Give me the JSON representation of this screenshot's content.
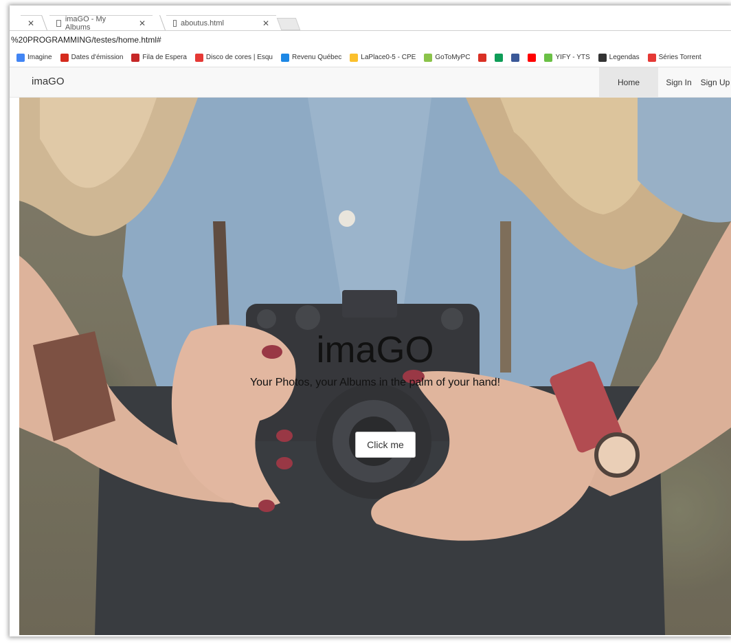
{
  "browser": {
    "tabs": [
      {
        "label": "imaGO - My Albums"
      },
      {
        "label": "aboutus.html"
      }
    ],
    "address": "%20PROGRAMMING/testes/home.html#",
    "bookmarks": [
      {
        "label": "Imagine",
        "icon": "apps-grid-icon",
        "color": "#4285f4"
      },
      {
        "label": "Dates d'émission",
        "icon": "maple-leaf-icon",
        "color": "#d52b1e"
      },
      {
        "label": "Fila de Espera",
        "icon": "bookmark-flag-icon",
        "color": "#c62828"
      },
      {
        "label": "Disco de cores | Esqu",
        "icon": "color-wheel-icon",
        "color": "#e53935"
      },
      {
        "label": "Revenu Québec",
        "icon": "revenu-icon",
        "color": "#1e88e5"
      },
      {
        "label": "LaPlace0-5 - CPE",
        "icon": "circle-icon",
        "color": "#fbc02d"
      },
      {
        "label": "GoToMyPC",
        "icon": "gotomypc-icon",
        "color": "#8bc34a"
      },
      {
        "label": "",
        "icon": "gmail-icon",
        "color": "#d93025"
      },
      {
        "label": "",
        "icon": "drive-icon",
        "color": "#0f9d58"
      },
      {
        "label": "",
        "icon": "facebook-icon",
        "color": "#3b5998"
      },
      {
        "label": "",
        "icon": "youtube-icon",
        "color": "#ff0000"
      },
      {
        "label": "YIFY - YTS",
        "icon": "yts-icon",
        "color": "#6ac045"
      },
      {
        "label": "Legendas",
        "icon": "legendas-icon",
        "color": "#333333"
      },
      {
        "label": "Séries Torrent",
        "icon": "series-icon",
        "color": "#e53935"
      }
    ]
  },
  "site": {
    "brand": "imaGO",
    "nav": [
      {
        "label": "Home",
        "active": true
      },
      {
        "label": "Sign In",
        "active": false
      },
      {
        "label": "Sign Up",
        "active": false
      }
    ],
    "hero": {
      "title": "imaGO",
      "subtitle": "Your Photos, your Albums in the palm of your hand!",
      "button": "Click me"
    }
  }
}
